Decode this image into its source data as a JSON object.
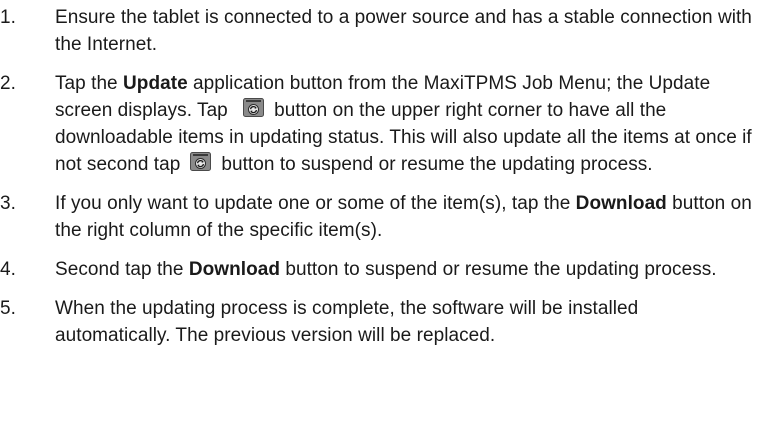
{
  "steps": [
    {
      "num": "1.",
      "text": "Ensure the tablet is connected to a power source and has a stable connection with the Internet."
    },
    {
      "num": "2.",
      "p1": "Tap the ",
      "b1": "Update",
      "p2": " application button from the MaxiTPMS Job Menu; the Update screen displays. Tap ",
      "p3": "button on the upper right corner to have all the downloadable items in updating status. This will also update all the items at once if not second tap",
      "p4": "button to suspend or resume the updating process."
    },
    {
      "num": "3.",
      "p1": "If you only want to update one or some of the item(s), tap the ",
      "b1": "Download",
      "p2": " button on the right column of the specific item(s)."
    },
    {
      "num": "4.",
      "p1": "Second tap the ",
      "b1": "Download",
      "p2": " button to suspend or resume the updating process."
    },
    {
      "num": "5.",
      "text": "When the updating process is complete, the software will be installed automatically. The previous version will be replaced."
    }
  ],
  "icons": {
    "update_all": "update-all-icon"
  }
}
